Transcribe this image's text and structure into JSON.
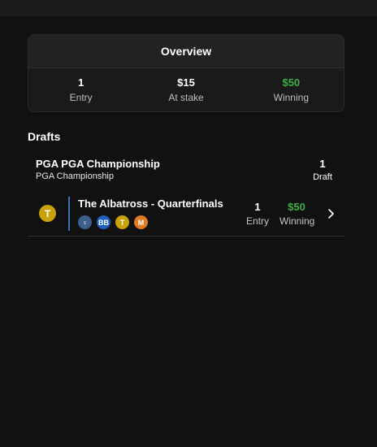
{
  "overview": {
    "title": "Overview",
    "stats": [
      {
        "value": "1",
        "label": "Entry"
      },
      {
        "value": "$15",
        "label": "At stake"
      },
      {
        "value": "$50",
        "label": "Winning"
      }
    ]
  },
  "drafts": {
    "title": "Drafts",
    "event": {
      "name": "PGA PGA Championship",
      "subtitle": "PGA Championship",
      "count": "1",
      "count_label": "Draft"
    },
    "row": {
      "avatar": "T",
      "name": "The Albatross - Quarterfinals",
      "players": [
        {
          "text": "♀",
          "color": "#3a5f8a"
        },
        {
          "text": "BB",
          "color": "#1f5fbf"
        },
        {
          "text": "T",
          "color": "#c9a10a"
        },
        {
          "text": "M",
          "color": "#e07b22"
        }
      ],
      "entry_value": "1",
      "entry_label": "Entry",
      "winning_value": "$50",
      "winning_label": "Winning"
    }
  },
  "colors": {
    "winning": "#3cb043",
    "accent_line": "#3f6fb5"
  }
}
